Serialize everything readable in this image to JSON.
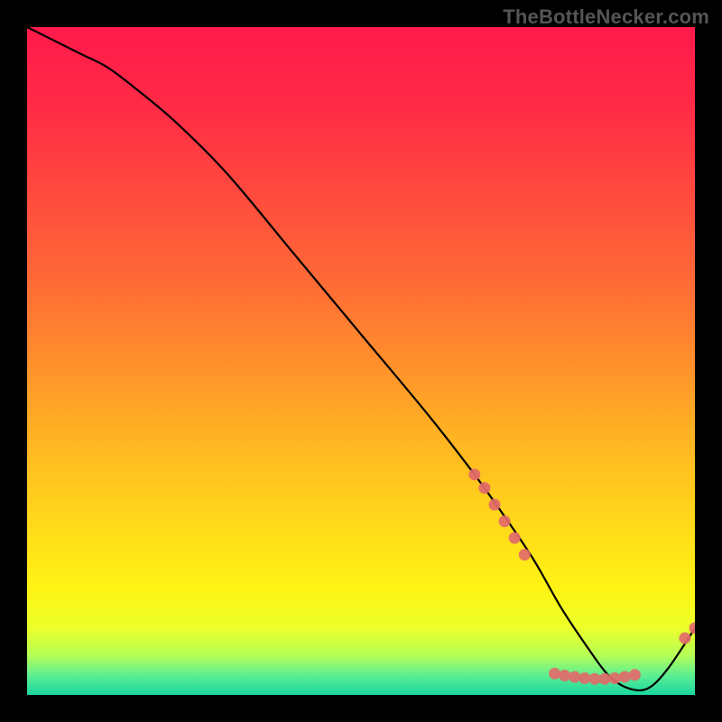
{
  "watermark": "TheBottleNecker.com",
  "chart_data": {
    "type": "line",
    "title": "",
    "xlabel": "",
    "ylabel": "",
    "xlim": [
      0,
      100
    ],
    "ylim": [
      0,
      100
    ],
    "grid": false,
    "legend": false,
    "series": [
      {
        "name": "curve",
        "x": [
          0,
          4,
          8,
          12,
          16,
          22,
          30,
          40,
          50,
          60,
          67,
          72,
          76,
          80,
          84,
          87,
          90,
          93,
          96,
          100
        ],
        "y": [
          100,
          98,
          96,
          94,
          91,
          86,
          78,
          66,
          54,
          42,
          33,
          26,
          20,
          13,
          7,
          3,
          1,
          1,
          4,
          10
        ]
      }
    ],
    "markers": [
      {
        "x": 67.0,
        "y": 33.0
      },
      {
        "x": 68.5,
        "y": 31.0
      },
      {
        "x": 70.0,
        "y": 28.5
      },
      {
        "x": 71.5,
        "y": 26.0
      },
      {
        "x": 73.0,
        "y": 23.5
      },
      {
        "x": 74.5,
        "y": 21.0
      },
      {
        "x": 79.0,
        "y": 3.2
      },
      {
        "x": 80.5,
        "y": 2.9
      },
      {
        "x": 82.0,
        "y": 2.7
      },
      {
        "x": 83.5,
        "y": 2.5
      },
      {
        "x": 85.0,
        "y": 2.4
      },
      {
        "x": 86.5,
        "y": 2.4
      },
      {
        "x": 88.0,
        "y": 2.5
      },
      {
        "x": 89.5,
        "y": 2.7
      },
      {
        "x": 91.0,
        "y": 3.0
      },
      {
        "x": 98.5,
        "y": 8.5
      },
      {
        "x": 100.0,
        "y": 10.0
      }
    ],
    "gradient_stops": [
      {
        "offset": 0.0,
        "color": "#ff1a4b"
      },
      {
        "offset": 0.12,
        "color": "#ff2b46"
      },
      {
        "offset": 0.25,
        "color": "#ff4a3e"
      },
      {
        "offset": 0.38,
        "color": "#ff6a36"
      },
      {
        "offset": 0.5,
        "color": "#ff8f2c"
      },
      {
        "offset": 0.62,
        "color": "#ffb522"
      },
      {
        "offset": 0.74,
        "color": "#ffd81a"
      },
      {
        "offset": 0.84,
        "color": "#fff314"
      },
      {
        "offset": 0.9,
        "color": "#ecff2a"
      },
      {
        "offset": 0.94,
        "color": "#b7ff55"
      },
      {
        "offset": 0.97,
        "color": "#5fef90"
      },
      {
        "offset": 1.0,
        "color": "#18d6a0"
      }
    ],
    "marker_color": "#e26a6a",
    "curve_color": "#000000"
  }
}
